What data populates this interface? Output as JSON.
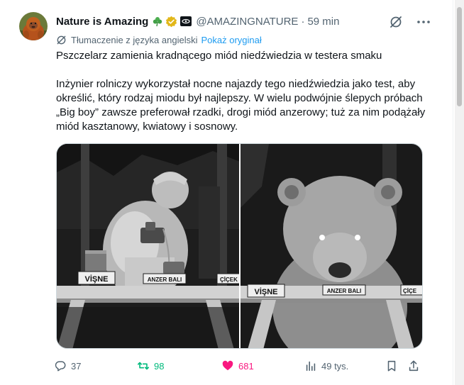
{
  "author": {
    "display_name": "Nature is Amazing",
    "emoji": "☘️",
    "handle": "@AMAZINGNATURE",
    "separator": "·",
    "time": "59 min"
  },
  "translation": {
    "label": "Tłumaczenie z języka angielski",
    "show_original": "Pokaż oryginał"
  },
  "tweet": {
    "paragraphs": [
      "Pszczelarz zamienia kradnącego miód niedźwiedzia w testera smaku",
      "Inżynier rolniczy wykorzystał nocne najazdy tego niedźwiedzia jako test, aby określić, który rodzaj miodu był najlepszy. W wielu podwójnie ślepych próbach „Big boy” zawsze preferował rzadki, drogi miód anzerowy; tuż za nim podążały miód kasztanowy, kwiatowy i sosnowy."
    ]
  },
  "media": {
    "left_labels": [
      "VİŞNE",
      "ANZER BALI",
      "ÇİÇEK"
    ],
    "right_labels": [
      "VİŞNE",
      "ANZER BALI",
      "ÇİÇE"
    ]
  },
  "actions": {
    "replies": "37",
    "reposts": "98",
    "likes": "681",
    "views": "49 tys."
  },
  "icons": {
    "reply": "reply-icon",
    "retweet": "retweet-icon",
    "like": "heart-icon",
    "views": "views-icon",
    "bookmark": "bookmark-icon",
    "share": "share-icon",
    "grok": "grok-icon",
    "more": "more-icon",
    "translate": "translate-icon",
    "verified": "verified-badge-icon",
    "affiliate": "affiliate-badge-icon"
  },
  "colors": {
    "text": "#0f1419",
    "secondary": "#536471",
    "link": "#1d9bf0",
    "retweet_active": "#00ba7c",
    "like_active": "#f91880",
    "verified_gold": "#e2b719"
  }
}
